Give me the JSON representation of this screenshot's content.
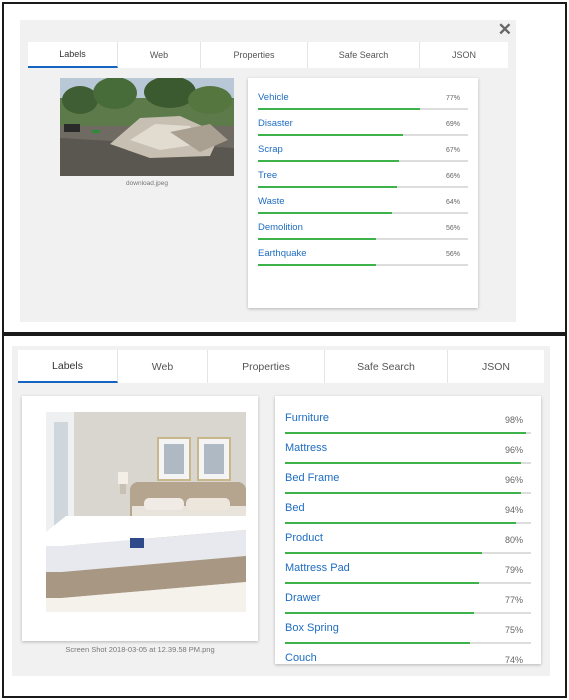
{
  "panel1": {
    "tabs": [
      "Labels",
      "Web",
      "Properties",
      "Safe Search",
      "JSON"
    ],
    "close_icon": "close-icon",
    "image_caption": "download.jpeg",
    "labels": [
      {
        "name": "Vehicle",
        "score": "77%",
        "fraction": 0.77
      },
      {
        "name": "Disaster",
        "score": "69%",
        "fraction": 0.69
      },
      {
        "name": "Scrap",
        "score": "67%",
        "fraction": 0.67
      },
      {
        "name": "Tree",
        "score": "66%",
        "fraction": 0.66
      },
      {
        "name": "Waste",
        "score": "64%",
        "fraction": 0.64
      },
      {
        "name": "Demolition",
        "score": "56%",
        "fraction": 0.56
      },
      {
        "name": "Earthquake",
        "score": "56%",
        "fraction": 0.56
      }
    ]
  },
  "panel2": {
    "tabs": [
      "Labels",
      "Web",
      "Properties",
      "Safe Search",
      "JSON"
    ],
    "image_caption": "Screen Shot 2018-03-05 at 12.39.58 PM.png",
    "labels": [
      {
        "name": "Furniture",
        "score": "98%",
        "fraction": 0.98
      },
      {
        "name": "Mattress",
        "score": "96%",
        "fraction": 0.96
      },
      {
        "name": "Bed Frame",
        "score": "96%",
        "fraction": 0.96
      },
      {
        "name": "Bed",
        "score": "94%",
        "fraction": 0.94
      },
      {
        "name": "Product",
        "score": "80%",
        "fraction": 0.8
      },
      {
        "name": "Mattress Pad",
        "score": "79%",
        "fraction": 0.79
      },
      {
        "name": "Drawer",
        "score": "77%",
        "fraction": 0.77
      },
      {
        "name": "Box Spring",
        "score": "75%",
        "fraction": 0.75
      },
      {
        "name": "Couch",
        "score": "74%",
        "fraction": 0.74
      }
    ]
  },
  "colors": {
    "accent": "#1565c0",
    "bar": "#3db14a",
    "label_text": "#1e6cc0"
  }
}
